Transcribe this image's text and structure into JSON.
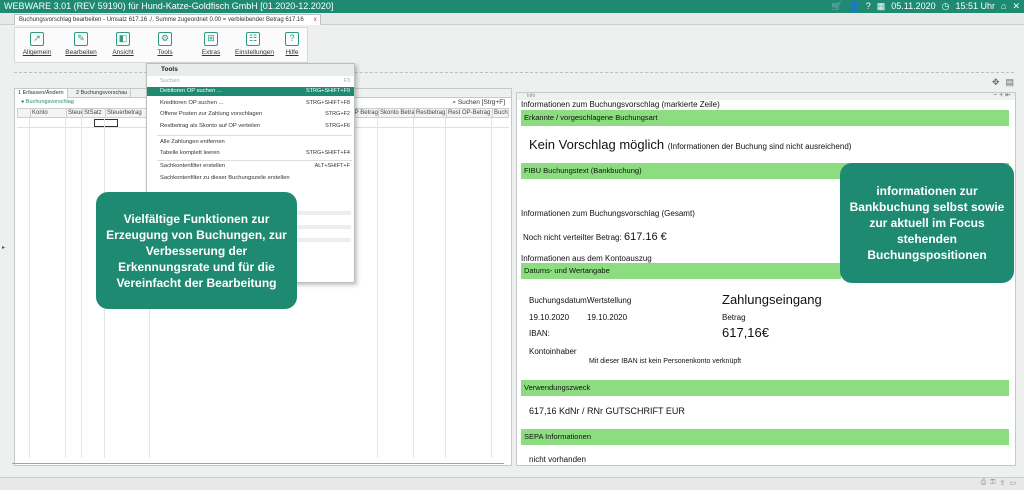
{
  "titlebar": {
    "title": "WEBWARE 3.01 (REV 59190) für Hund-Katze-Goldfisch GmbH  [01.2020-12.2020]",
    "date": "05.11.2020",
    "time": "15:51 Uhr"
  },
  "doc_tab": {
    "label": "Buchungsvorschlag bearbeiten - Umsatz 617.16 ./. Summe zugeordnet 0.00 = verbleibender Betrag 617.16",
    "close": "x"
  },
  "ribbon": {
    "buttons": [
      {
        "label": "Allgemein",
        "icon": "arrow-icon"
      },
      {
        "label": "Bearbeiten",
        "icon": "edit-icon"
      },
      {
        "label": "Ansicht",
        "icon": "view-icon"
      },
      {
        "label": "Tools",
        "icon": "tools-icon"
      },
      {
        "label": "Extras",
        "icon": "extras-icon"
      },
      {
        "label": "Einstellungen",
        "icon": "settings-icon"
      },
      {
        "label": "Hilfe",
        "icon": "help-icon"
      }
    ]
  },
  "left_panel": {
    "tabs": [
      "1 Erfassen/Ändern",
      "2 Buchungsvorschau"
    ],
    "subheader": "Buchungsvorschlag",
    "search": "Suchen [Strg+F]",
    "columns": [
      "Konto",
      "Steue",
      "StSatz",
      "Steuerbetrag",
      "OP Betrag",
      "Skonto Betrag",
      "Restbetrag",
      "Rest OP-Betrag",
      "Buch"
    ]
  },
  "tools_menu": {
    "title": "Tools",
    "items": [
      {
        "label": "Suchen",
        "shortcut": "F3",
        "state": "disabled"
      },
      {
        "label": "Debitoren OP suchen ...",
        "shortcut": "STRG+SHIFT+F9",
        "state": "highlight"
      },
      {
        "label": "Kreditoren OP suchen ...",
        "shortcut": "STRG+SHIFT+F8",
        "state": ""
      },
      {
        "label": "Offene Posten zur Zahlung vorschlagen",
        "shortcut": "STRG+F2",
        "state": ""
      },
      {
        "label": "Restbetrag als Skonto auf OP verteilen",
        "shortcut": "STRG+F6",
        "state": ""
      },
      {
        "label": "Alle Zahlungen entfernen",
        "shortcut": "",
        "state": ""
      },
      {
        "label": "Tabelle komplett leeren",
        "shortcut": "STRG+SHIFT+F4",
        "state": ""
      },
      {
        "label": "Sachkontenfilter erstellen",
        "shortcut": "ALT+SHIFT+F",
        "state": ""
      },
      {
        "label": "Sachkontenfilter zu dieser Buchungszeile erstellen",
        "shortcut": "",
        "state": ""
      }
    ]
  },
  "callouts": {
    "left": "Vielfältige Funktionen zur Erzeugung von Buchungen, zur Verbesserung der Erkennungsrate und für die Vereinfacht der Bearbeitung",
    "right": "informationen zur Bankbuchung selbst sowie zur aktuell im Focus stehenden Buchungspositionen"
  },
  "info_panel": {
    "tab": "Info",
    "heading": "Informationen zum Buchungsvorschlag (markierte Zeile)",
    "bar1": "Erkannte / vorgeschlagene Buchungsart",
    "no_suggestion": "Kein Vorschlag möglich",
    "no_suggestion_note": "(Informationen der Buchung sind nicht ausreichend)",
    "bar2": "FIBU Buchungstext (Bankbuchung)",
    "total_heading": "Informationen zum Buchungsvorschlag (Gesamt)",
    "not_distributed_label": "Noch nicht verteilter Betrag:",
    "not_distributed_value": "617.16 €",
    "statement_heading": "Informationen aus dem Kontoauszug",
    "bar3": "Datums- und Wertangabe",
    "booking_date_label": "Buchungsdatum",
    "value_date_label": "Wertstellung",
    "payment_type": "Zahlungseingang",
    "booking_date": "19.10.2020",
    "value_date": "19.10.2020",
    "amount_label": "Betrag",
    "iban_label": "IBAN:",
    "amount": "617,16€",
    "holder_label": "Kontoinhaber",
    "iban_note": "Mit dieser IBAN ist kein Personenkonto verknüpft",
    "bar4": "Verwendungszweck",
    "purpose": "617,16 KdNr / RNr GUTSCHRIFT EUR",
    "bar5": "SEPA Informationen",
    "sepa": "nicht vorhanden"
  }
}
